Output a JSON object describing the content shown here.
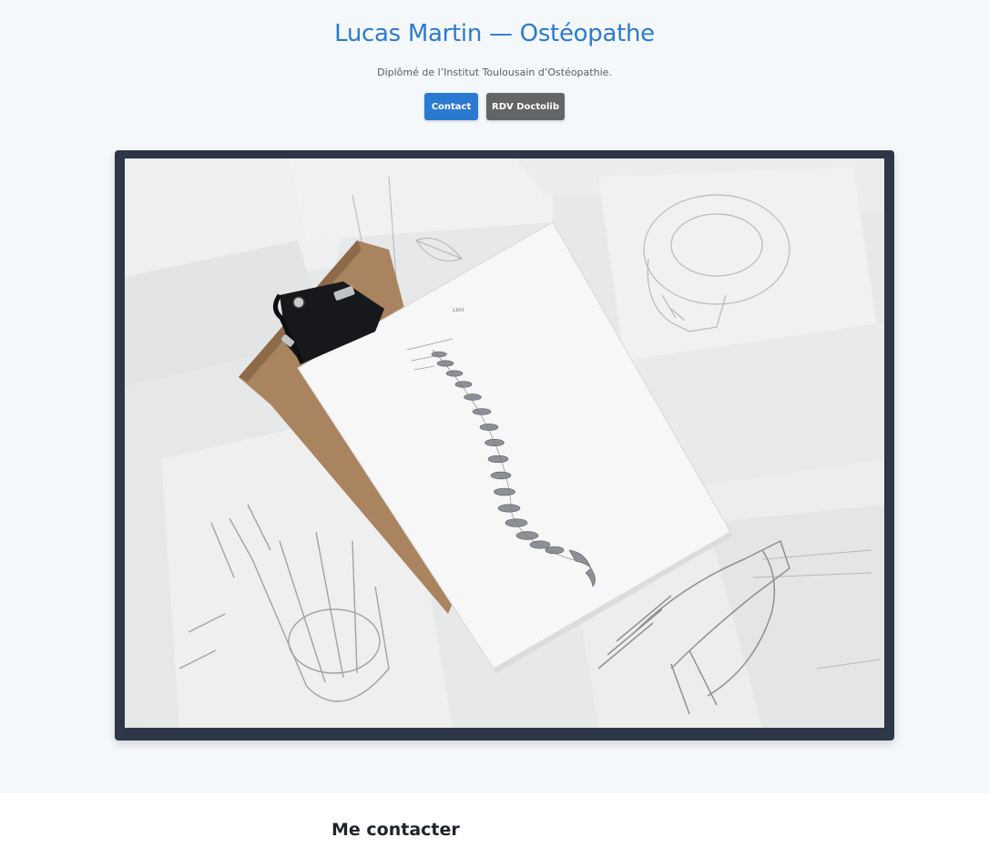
{
  "hero": {
    "title": "Lucas Martin — Ostéopathe",
    "subtitle": "Diplômé de l’Institut Toulousain d’Ostéopathie.",
    "buttons": {
      "contact": "Contact",
      "doctolib": "RDV Doctolib"
    }
  },
  "photo": {
    "description_icon": "anatomy-photo",
    "sheet_header": "LXVI"
  },
  "contact": {
    "title": "Me contacter"
  },
  "colors": {
    "accent": "#2b7bd0",
    "primary_button": "#2b7ad2",
    "secondary_button": "#626465",
    "frame": "#2d3748",
    "background": "#f5f8fb"
  }
}
